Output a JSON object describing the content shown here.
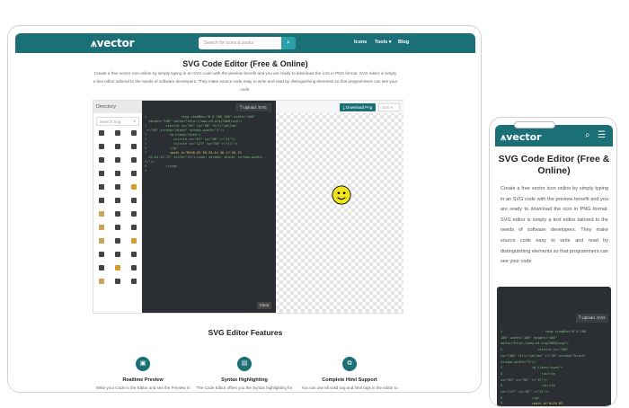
{
  "brand": {
    "name": "vector",
    "accent": "#1b6f77"
  },
  "nav": {
    "search_placeholder": "Search for icons & packs",
    "links": [
      "Icons",
      "Tools",
      "Blog"
    ]
  },
  "hero": {
    "title": "SVG Code Editor (Free & Online)",
    "description": "Create a free vector icon online by simply typing in an SVG code with the preview benefit and you are ready to download the icon in PNG format. SVG editor is simply a text editor tailored to the needs of software developers. They make source code easy to write and read by distinguishing elements so that programmers can see your code."
  },
  "editor": {
    "directory_label": "Directory",
    "search_placeholder": "Search Svg",
    "upload_label": "Upload .SVG",
    "download_label": "Download Png",
    "size_label": "Size",
    "clear_label": "Clear"
  },
  "features": {
    "title": "SVG Editor Features",
    "items": [
      {
        "title": "Realtime Preview",
        "desc": "Write your Code in the Editor and see the Preview in the real time as you draw it."
      },
      {
        "title": "Syntax Highlighting",
        "desc": "The Code Editor offers you the Syntax highlighting for your code so that its easy to write and read."
      },
      {
        "title": "Complete Html Support",
        "desc": "You can use all valid svg and html tags in the editor to make your svg."
      }
    ]
  },
  "mobile": {
    "title": "SVG Code Editor (Free & Online)",
    "description": "Create a free vector icon online by simply typing in an SVG code with the preview benefit and you are ready to download the icon in PNG format. SVG editor is simply a text editor tailored to the needs of software developers. They make source code easy to write and read by distinguishing elements so that programmers can see your code",
    "upload_label": "Upload .SVG"
  }
}
